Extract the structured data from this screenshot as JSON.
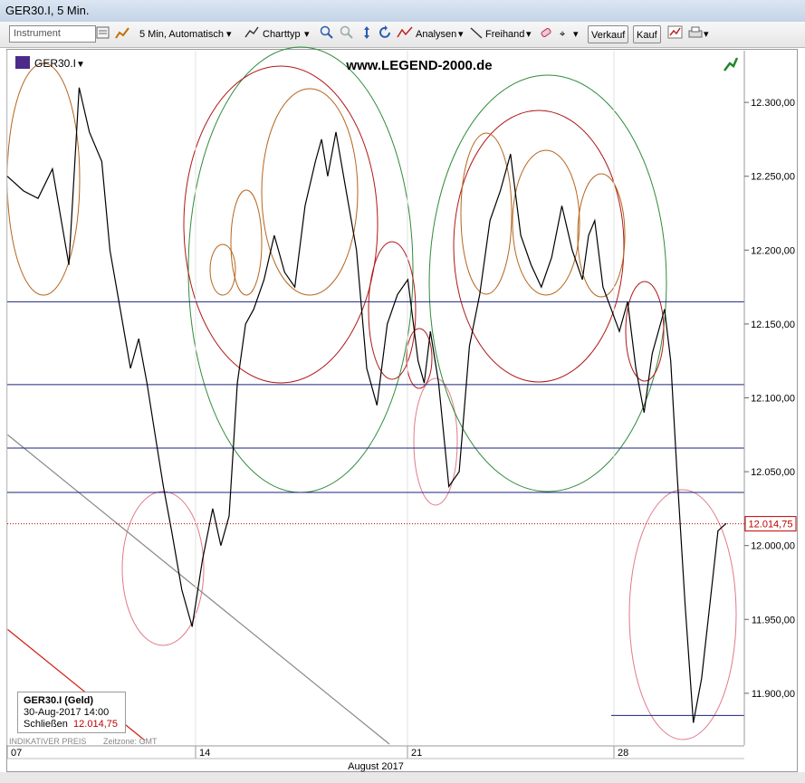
{
  "window": {
    "title": "GER30.I, 5 Min."
  },
  "toolbar": {
    "instrument_placeholder": "Instrument",
    "interval_label": "5 Min,  Automatisch",
    "charttype_label": "Charttyp",
    "analysen_label": "Analysen",
    "freihand_label": "Freihand",
    "verkauf_label": "Verkauf",
    "kauf_label": "Kauf"
  },
  "chart": {
    "instrument_label": "GER30.I",
    "watermark": "www.LEGEND-2000.de",
    "footer_left": "INDIKATIVER PREIS",
    "footer_tz": "Zeitzone: GMT",
    "month_label": "August 2017",
    "current_price_label": "12.014,75"
  },
  "infobox": {
    "title": "GER30.I (Geld)",
    "datetime": "30-Aug-2017 14:00",
    "close_label": "Schließen",
    "close_value": "12.014,75"
  },
  "colors": {
    "price_line": "#000000",
    "horizontal_lines": "#1a237e",
    "current_price": "#c00000",
    "green_circle": "#2e8b3a",
    "red_circle": "#b01818",
    "orange_circle": "#b5651d",
    "pink_circle": "#e07a8a"
  },
  "chart_data": {
    "type": "line",
    "title": "GER30.I, 5 Min.",
    "xlabel": "August 2017",
    "ylabel": "",
    "x_ticks": [
      "07",
      "14",
      "21",
      "28"
    ],
    "y_ticks": [
      11900,
      11950,
      12000,
      12050,
      12100,
      12150,
      12200,
      12250,
      12300
    ],
    "y_tick_labels": [
      "11.900,00",
      "11.950,00",
      "12.000,00",
      "12.050,00",
      "12.100,00",
      "12.150,00",
      "12.200,00",
      "12.250,00",
      "12.300,00"
    ],
    "ylim": [
      11865,
      12335
    ],
    "current_price": 12014.75,
    "horizontal_levels": [
      12165,
      12109,
      12066,
      12036,
      11885
    ],
    "series": [
      {
        "x": [
          0,
          0.8,
          1.5,
          2.2,
          3,
          3.5,
          4,
          4.6,
          5,
          5.5,
          6,
          6.4,
          6.8,
          7.2,
          7.6,
          8,
          8.5,
          9,
          9.5,
          10,
          10.4,
          10.8,
          11.2,
          11.6,
          12,
          12.5,
          13,
          13.5,
          14,
          14.5,
          15,
          15.3,
          15.6,
          16,
          16.5,
          17,
          17.5,
          18,
          18.5,
          19,
          19.5,
          20,
          20.3,
          20.6,
          21,
          21.5,
          22,
          22.5,
          23,
          23.5,
          24,
          24.5,
          25,
          25.5,
          26,
          26.5,
          27,
          27.5,
          28,
          28.3,
          28.6,
          29,
          29.4,
          29.8,
          30.2,
          30.6,
          31,
          31.4,
          32,
          32.3,
          32.6,
          33,
          33.4,
          33.8,
          34.2,
          34.6,
          35
        ],
        "y": [
          12250,
          12240,
          12235,
          12255,
          12190,
          12310,
          12280,
          12260,
          12200,
          12160,
          12120,
          12140,
          12110,
          12075,
          12040,
          12010,
          11970,
          11945,
          11990,
          12025,
          12000,
          12020,
          12110,
          12150,
          12160,
          12180,
          12210,
          12185,
          12175,
          12230,
          12260,
          12275,
          12250,
          12280,
          12240,
          12200,
          12120,
          12095,
          12150,
          12170,
          12180,
          12125,
          12110,
          12145,
          12110,
          12040,
          12050,
          12135,
          12170,
          12220,
          12240,
          12265,
          12210,
          12190,
          12175,
          12195,
          12230,
          12200,
          12180,
          12210,
          12220,
          12175,
          12160,
          12145,
          12165,
          12120,
          12090,
          12130,
          12160,
          12125,
          12050,
          11960,
          11880,
          11910,
          11960,
          12010,
          12015
        ]
      }
    ],
    "annotations": [
      "www.LEGEND-2000.de"
    ]
  }
}
